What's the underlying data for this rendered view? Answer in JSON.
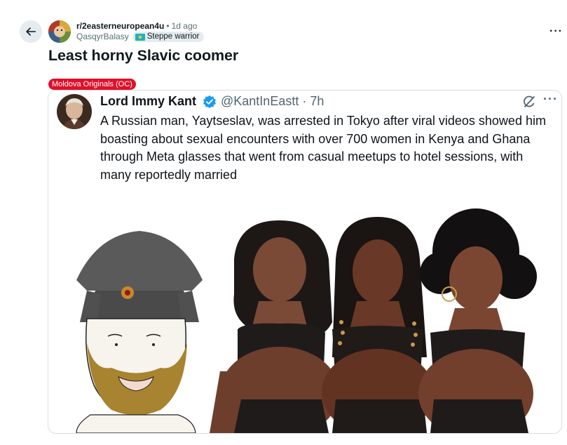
{
  "post": {
    "subreddit": "r/2easterneuropean4u",
    "separator": "•",
    "time": "1d ago",
    "author": "QasqyrBalasy",
    "user_flair": "Steppe warrior",
    "title": "Least horny Slavic coomer",
    "post_flair": "Moldova Originals (OC)"
  },
  "tweet": {
    "name": "Lord Immy Kant",
    "handle": "@KantInEastt · 7h",
    "text": "A Russian man, Yaytseslav, was arrested in Tokyo after viral videos showed him boasting about sexual encounters with over 700 women in Kenya and Ghana through Meta glasses that went from casual meetups to hotel sessions, with many reportedly married"
  },
  "icons": {
    "back": "arrow-left-icon",
    "more": "ellipsis-icon",
    "verified": "verified-badge-icon",
    "grok": "grok-icon"
  },
  "colors": {
    "flair_red": "#e0102a",
    "verified_blue": "#1d9bf0",
    "button_gray": "#e5ebee"
  }
}
